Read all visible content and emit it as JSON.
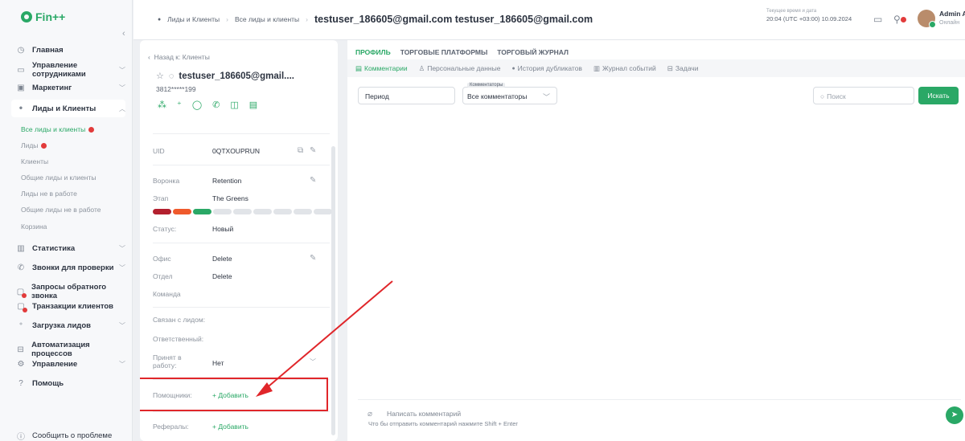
{
  "app": {
    "logo_text": "Fin++"
  },
  "sidebar": {
    "items": [
      {
        "label": "Главная",
        "icon": "clock-icon"
      },
      {
        "label": "Управление сотрудниками",
        "icon": "id-card-icon"
      },
      {
        "label": "Маркетинг",
        "icon": "image-icon"
      },
      {
        "label": "Лиды и Клиенты",
        "icon": "users-icon"
      },
      {
        "label": "Статистика",
        "icon": "bar-chart-icon"
      },
      {
        "label": "Звонки для проверки",
        "icon": "phone-icon"
      },
      {
        "label": "Запросы обратного звонка",
        "icon": "callback-icon"
      },
      {
        "label": "Транзакции клиентов",
        "icon": "transaction-icon"
      },
      {
        "label": "Загрузка лидов",
        "icon": "user-plus-icon"
      },
      {
        "label": "Автоматизация процессов",
        "icon": "automation-icon"
      },
      {
        "label": "Управление",
        "icon": "settings-icon"
      },
      {
        "label": "Помощь",
        "icon": "help-icon"
      }
    ],
    "subitems": [
      "Все лиды и клиенты",
      "Лиды",
      "Клиенты",
      "Общие лиды и клиенты",
      "Лиды не в работе",
      "Общие лиды не в работе",
      "Корзина"
    ],
    "report": "Сообщить о проблеме"
  },
  "header": {
    "crumb1": "Лиды и Клиенты",
    "crumb2": "Все лиды и клиенты",
    "title": "testuser_186605@gmail.com testuser_186605@gmail.com",
    "datetime_label": "Текущее время и дата",
    "datetime": "20:04 (UTC +03:00) 10.09.2024",
    "user_name": "Admin A",
    "user_status": "Онлайн"
  },
  "lead": {
    "back": "Назад к: Клиенты",
    "title": "testuser_186605@gmail....",
    "phone": "3812*****199",
    "fields": {
      "uid_label": "UID",
      "uid": "0QTXOUPRUN",
      "funnel_label": "Воронка",
      "funnel": "Retention",
      "stage_label": "Этап",
      "stage": "The Greens",
      "status_label": "Статус:",
      "status": "Новый",
      "office_label": "Офис",
      "office": "Delete",
      "dept_label": "Отдел",
      "dept": "Delete",
      "team_label": "Команда",
      "linked_label": "Связан с лидом:",
      "responsible_label": "Ответственный:",
      "accepted_label": "Принят в работу:",
      "accepted": "Нет",
      "assistants_label": "Помощники:",
      "add": "+ Добавить",
      "referrals_label": "Рефералы:"
    },
    "stage_colors": [
      "#b3202e",
      "#ef5a2c",
      "#2aa866"
    ],
    "stage_count": 9
  },
  "main": {
    "tabs": [
      "ПРОФИЛЬ",
      "ТОРГОВЫЕ ПЛАТФОРМЫ",
      "ТОРГОВЫЙ ЖУРНАЛ"
    ],
    "subtabs": [
      {
        "label": "Комментарии",
        "icon": "comment-icon"
      },
      {
        "label": "Персональные данные",
        "icon": "person-icon"
      },
      {
        "label": "История дубликатов",
        "icon": "users-icon"
      },
      {
        "label": "Журнал событий",
        "icon": "journal-icon"
      },
      {
        "label": "Задачи",
        "icon": "tasks-icon"
      }
    ],
    "period_placeholder": "Период",
    "commentators_label": "Комментаторы",
    "commentators_value": "Все комментаторы",
    "search_placeholder": "Поиск",
    "search_button": "Искать",
    "composer_placeholder": "Написать комментарий",
    "composer_hint": "Что бы отправить комментарий нажмите Shift + Enter"
  }
}
